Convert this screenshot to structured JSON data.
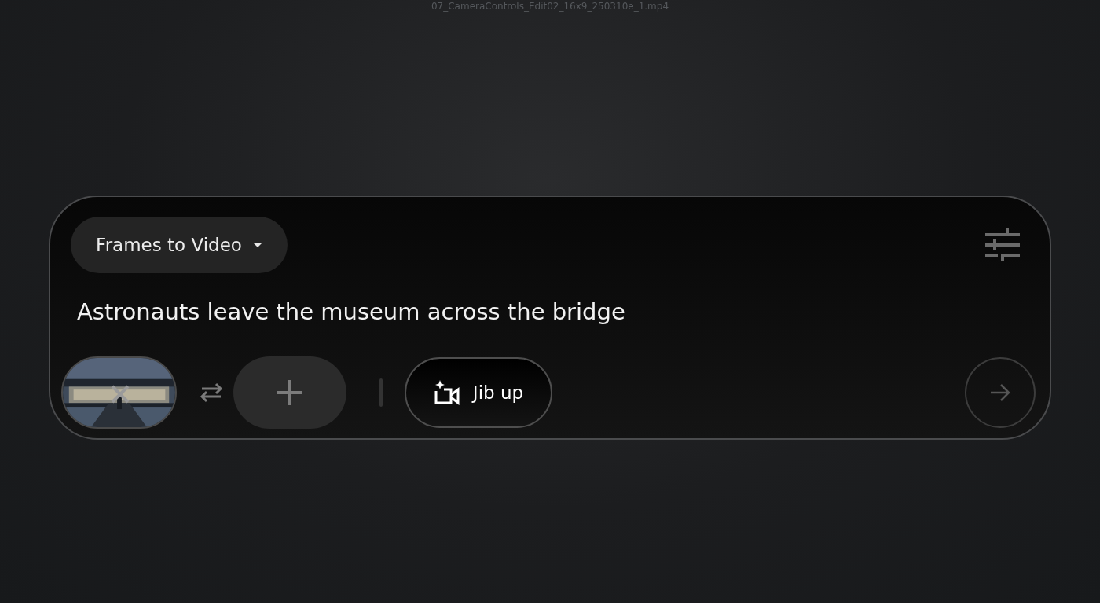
{
  "file_name": "07_CameraControls_Edit02_16x9_250310e_1.mp4",
  "mode_dropdown": {
    "label": "Frames to Video"
  },
  "prompt": {
    "value": "Astronauts leave the museum across the bridge"
  },
  "frames": [
    {
      "kind": "picture"
    },
    {
      "kind": "add"
    }
  ],
  "camera_chip": {
    "label": "Jib up"
  },
  "send_button": {
    "disabled": true
  }
}
